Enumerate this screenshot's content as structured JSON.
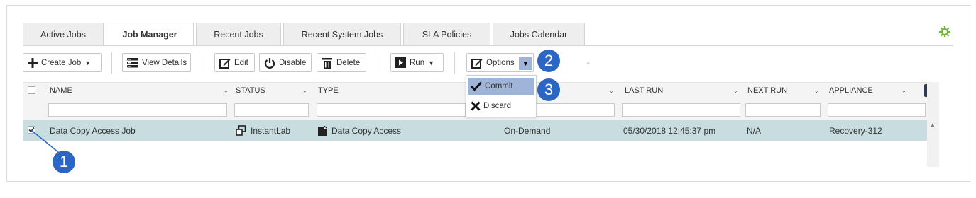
{
  "tabs": [
    {
      "label": "Active Jobs",
      "active": false
    },
    {
      "label": "Job Manager",
      "active": true
    },
    {
      "label": "Recent Jobs",
      "active": false
    },
    {
      "label": "Recent System Jobs",
      "active": false
    },
    {
      "label": "SLA Policies",
      "active": false
    },
    {
      "label": "Jobs Calendar",
      "active": false
    }
  ],
  "toolbar": {
    "create_job": "Create Job",
    "view_details": "View Details",
    "edit": "Edit",
    "disable": "Disable",
    "delete": "Delete",
    "run": "Run",
    "options": "Options",
    "dash": "-"
  },
  "options_menu": {
    "commit": "Commit",
    "discard": "Discard"
  },
  "callouts": {
    "one": "1",
    "two": "2",
    "three": "3"
  },
  "columns": {
    "name": "NAME",
    "status": "STATUS",
    "type": "TYPE",
    "last_run": "LAST RUN",
    "next_run": "NEXT RUN",
    "appliance": "APPLIANCE"
  },
  "rows": [
    {
      "checked": true,
      "name": "Data Copy Access Job",
      "status": "InstantLab",
      "type": "Data Copy Access",
      "schedule": "On-Demand",
      "last_run": "05/30/2018 12:45:37 pm",
      "next_run": "N/A",
      "appliance": "Recovery-312"
    }
  ],
  "colors": {
    "accent_blue": "#2b66c4",
    "selected_row": "#c7dde0",
    "menu_highlight": "#9fb4d9",
    "gear_green": "#76b33b"
  }
}
